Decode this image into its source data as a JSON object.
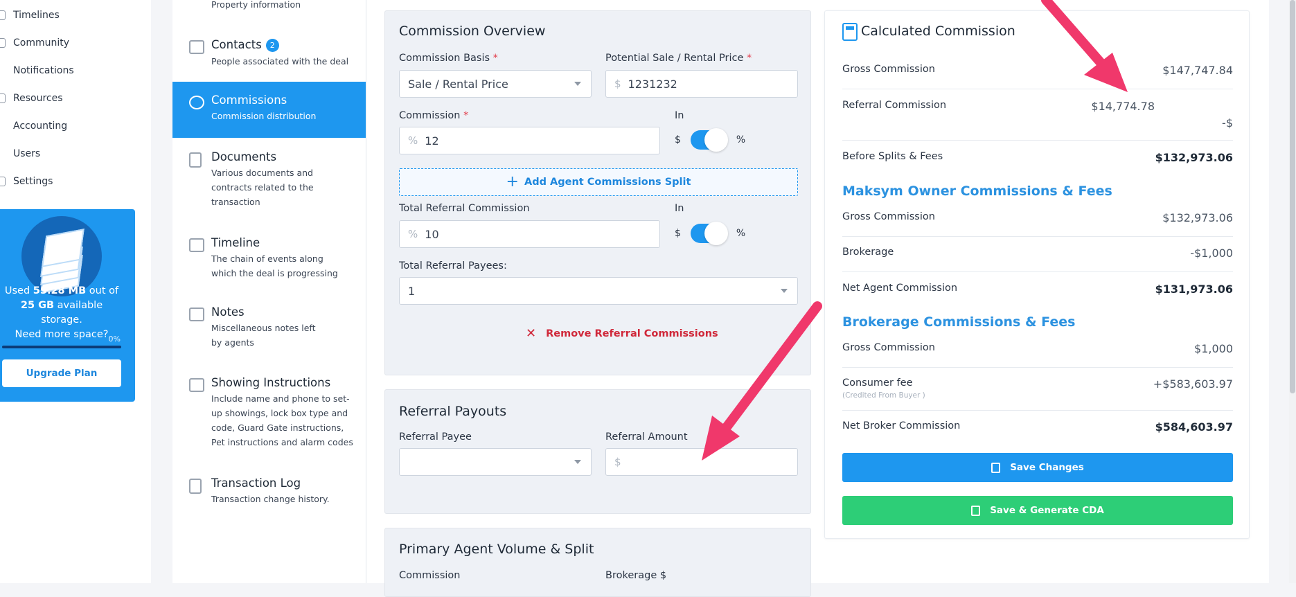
{
  "nav": {
    "items": [
      "Timelines",
      "Community",
      "Notifications",
      "Resources",
      "Accounting",
      "Users",
      "Settings"
    ]
  },
  "storage": {
    "used_prefix": "Used ",
    "used": "55.28 MB",
    "mid": " out of ",
    "total": "25 GB",
    "suffix": " available storage.",
    "question": "Need more space?",
    "percent_label": "0%",
    "percent_value": 0,
    "upgrade": "Upgrade Plan"
  },
  "sections": {
    "property_desc": "Property information",
    "contacts": {
      "title": "Contacts",
      "badge": "2",
      "desc": "People associated with the deal"
    },
    "commissions": {
      "title": "Commissions",
      "desc": "Commission distribution"
    },
    "documents": {
      "title": "Documents",
      "desc": "Various documents and contracts related to the transaction"
    },
    "timeline": {
      "title": "Timeline",
      "desc": "The chain of events along which the deal is progressing"
    },
    "notes": {
      "title": "Notes",
      "desc": "Miscellaneous notes left by agents"
    },
    "showing": {
      "title": "Showing Instructions",
      "desc": "Include name and phone to set-up showings, lock box type and code, Guard Gate instructions, Pet instructions and alarm codes"
    },
    "log": {
      "title": "Transaction Log",
      "desc": "Transaction change history."
    }
  },
  "overview": {
    "title": "Commission Overview",
    "basis_label": "Commission Basis",
    "basis_value": "Sale / Rental Price",
    "price_label": "Potential Sale / Rental Price",
    "price_prefix": "$",
    "price_value": "1231232",
    "commission_label": "Commission",
    "commission_prefix": "%",
    "commission_value": "12",
    "in_label": "In",
    "dollar": "$",
    "percent": "%",
    "add_split": "Add Agent Commissions Split",
    "ref_label": "Total Referral Commission",
    "ref_prefix": "%",
    "ref_value": "10",
    "payees_label": "Total Referral Payees:",
    "payees_value": "1",
    "remove_ref": "Remove Referral Commissions",
    "required_mark": "*"
  },
  "payouts": {
    "title": "Referral Payouts",
    "payee_label": "Referral Payee",
    "amount_label": "Referral Amount",
    "amount_prefix": "$"
  },
  "primary": {
    "title": "Primary Agent Volume & Split",
    "commission_label": "Commission",
    "brokerage_label": "Brokerage $"
  },
  "calc": {
    "title": "Calculated Commission",
    "gross_label": "Gross Commission",
    "gross_value": "$147,747.84",
    "referral_label": "Referral Commission",
    "referral_value": "$14,774.78",
    "referral_extra": "-$",
    "before_label": "Before Splits & Fees",
    "before_value": "$132,973.06",
    "owner_heading": "Maksym Owner Commissions & Fees",
    "owner_gross_label": "Gross Commission",
    "owner_gross_value": "$132,973.06",
    "brokerage_label": "Brokerage",
    "brokerage_value": "-$1,000",
    "net_agent_label": "Net Agent Commission",
    "net_agent_value": "$131,973.06",
    "broker_heading": "Brokerage Commissions & Fees",
    "broker_gross_label": "Gross Commission",
    "broker_gross_value": "$1,000",
    "consumer_label": "Consumer fee",
    "consumer_note": "(Credited From Buyer )",
    "consumer_value": "+$583,603.97",
    "net_broker_label": "Net Broker Commission",
    "net_broker_value": "$584,603.97",
    "save": "Save Changes",
    "save_cda": "Save & Generate CDA"
  },
  "colors": {
    "accent": "#1e97ef",
    "success": "#2dce77",
    "danger": "#d0283a",
    "annotation": "#f0386b"
  }
}
